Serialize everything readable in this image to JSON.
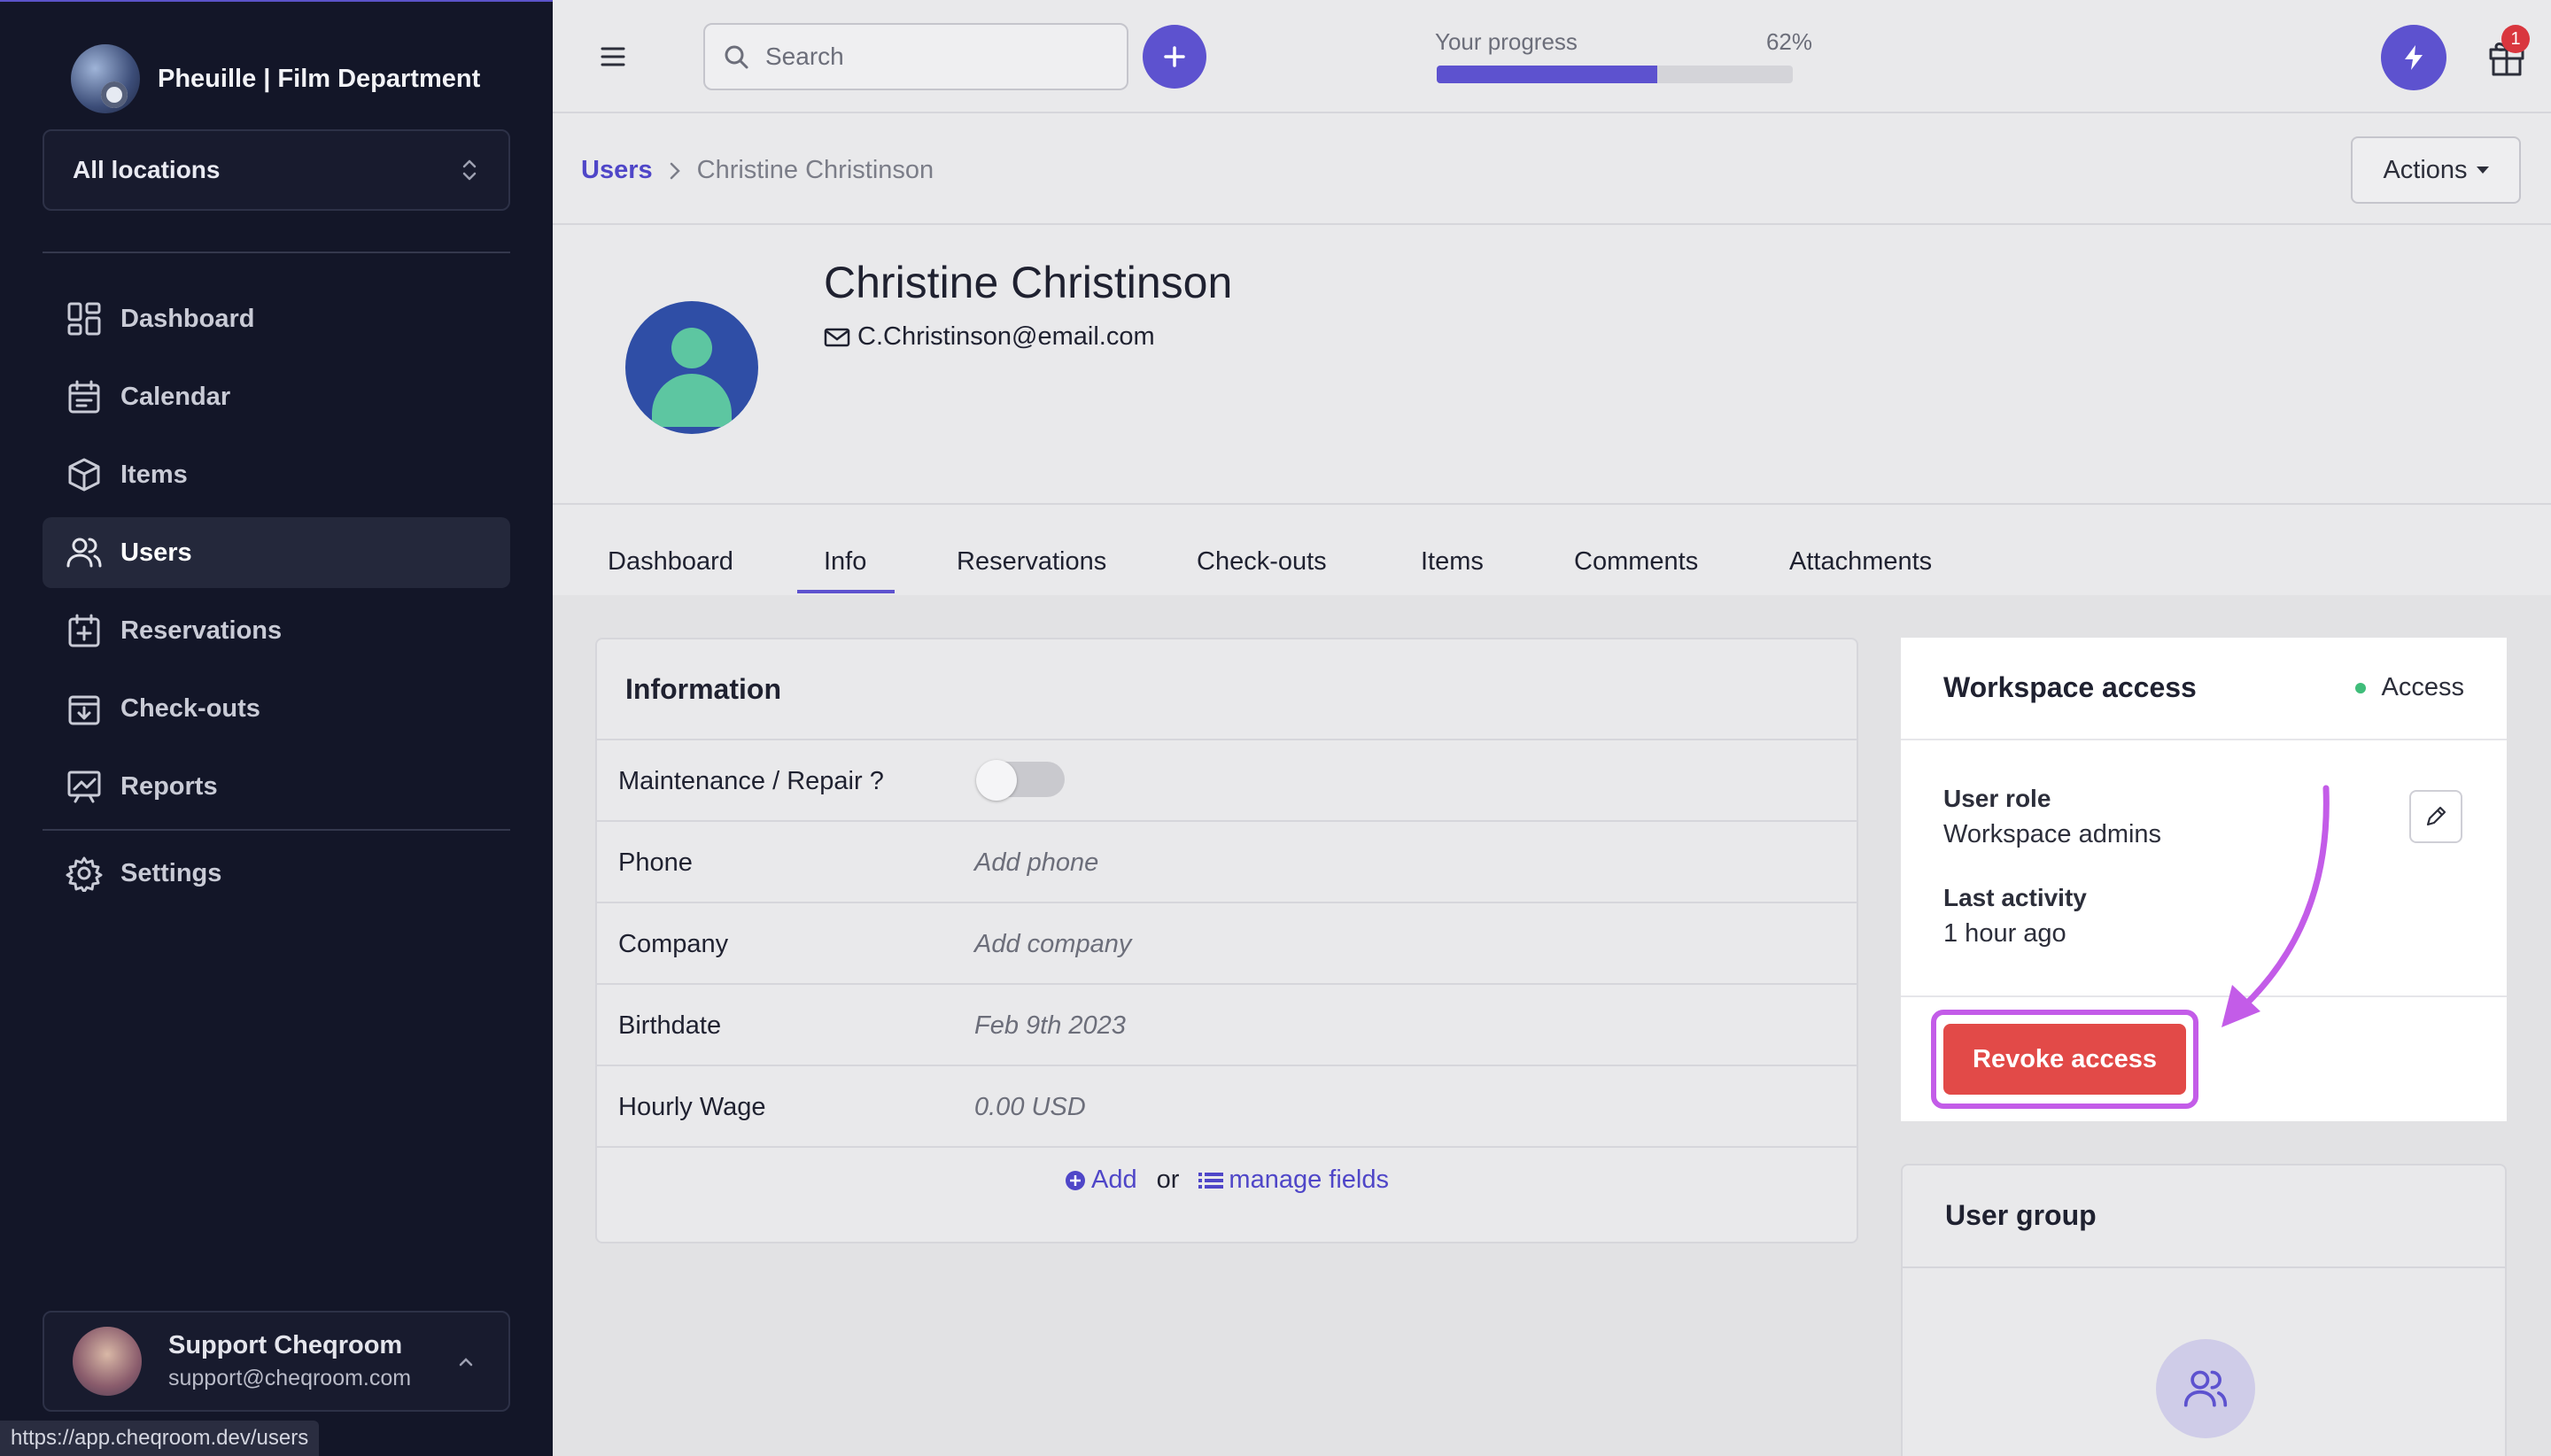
{
  "org": {
    "name": "Pheuille | Film Department"
  },
  "location_select": {
    "value": "All locations"
  },
  "nav": {
    "items": [
      {
        "label": "Dashboard",
        "icon": "dashboard-icon"
      },
      {
        "label": "Calendar",
        "icon": "calendar-icon"
      },
      {
        "label": "Items",
        "icon": "box-icon"
      },
      {
        "label": "Users",
        "icon": "users-icon",
        "active": true
      },
      {
        "label": "Reservations",
        "icon": "calendar-plus-icon"
      },
      {
        "label": "Check-outs",
        "icon": "calendar-download-icon"
      },
      {
        "label": "Reports",
        "icon": "chart-icon"
      }
    ],
    "settings": "Settings"
  },
  "account": {
    "name": "Support Cheqroom",
    "email": "support@cheqroom.com"
  },
  "status_url": "https://app.cheqroom.dev/users",
  "search": {
    "placeholder": "Search"
  },
  "progress": {
    "label": "Your progress",
    "value_text": "62%",
    "value": 0.62
  },
  "notifications": {
    "gift_badge": "1"
  },
  "breadcrumb": {
    "parent": "Users",
    "current": "Christine Christinson"
  },
  "actions_button": "Actions",
  "profile": {
    "name": "Christine Christinson",
    "email": "C.Christinson@email.com"
  },
  "tabs": [
    "Dashboard",
    "Info",
    "Reservations",
    "Check-outs",
    "Items",
    "Comments",
    "Attachments"
  ],
  "active_tab": "Info",
  "information": {
    "title": "Information",
    "fields": [
      {
        "label": "Maintenance / Repair ?",
        "type": "toggle",
        "on": false
      },
      {
        "label": "Phone",
        "value": "Add phone"
      },
      {
        "label": "Company",
        "value": "Add company"
      },
      {
        "label": "Birthdate",
        "value": "Feb 9th 2023"
      },
      {
        "label": "Hourly Wage",
        "value": "0.00 USD"
      }
    ],
    "add_label": "Add",
    "or_label": "or",
    "manage_label": "manage fields"
  },
  "workspace": {
    "title": "Workspace access",
    "status": "Access",
    "role_label": "User role",
    "role_value": "Workspace admins",
    "activity_label": "Last activity",
    "activity_value": "1 hour ago",
    "revoke_label": "Revoke access"
  },
  "user_group": {
    "title": "User group"
  },
  "colors": {
    "accent": "#5d52cf",
    "danger": "#e24a48",
    "highlight": "#c35ce8",
    "sidebar": "#131628",
    "status_ok": "#3fbd7a"
  }
}
